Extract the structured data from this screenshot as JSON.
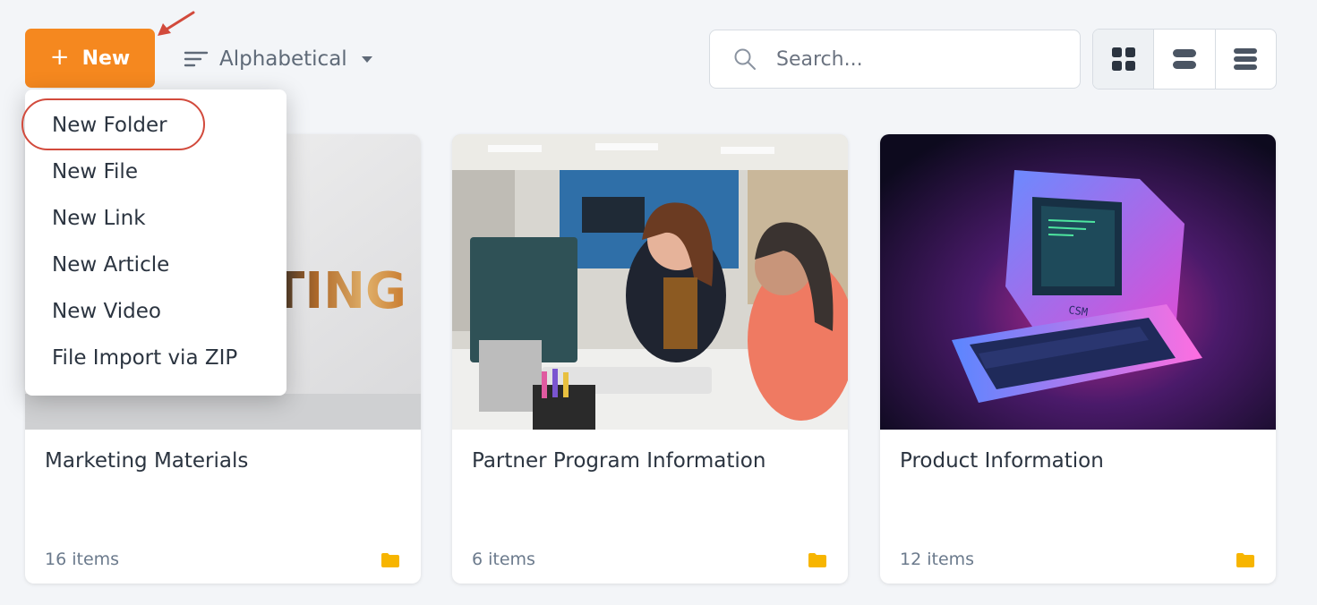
{
  "toolbar": {
    "new_label": "New",
    "new_icon": "plus-icon",
    "sort_label": "Alphabetical",
    "search_placeholder": "Search...",
    "accent_color": "#f5881f",
    "views": [
      "grid-view-icon",
      "list-view-icon",
      "compact-list-view-icon"
    ]
  },
  "menu": {
    "items": [
      {
        "label": "New Folder"
      },
      {
        "label": "New File"
      },
      {
        "label": "New Link"
      },
      {
        "label": "New Article"
      },
      {
        "label": "New Video"
      },
      {
        "label": "File Import via ZIP"
      }
    ]
  },
  "folders": [
    {
      "title": "Marketing Materials",
      "count": "16 items",
      "thumb_text": "TING"
    },
    {
      "title": "Partner Program Information",
      "count": "6 items"
    },
    {
      "title": "Product Information",
      "count": "12 items",
      "screen_text": "CSM"
    }
  ],
  "annotation_color": "#d24a3c",
  "folder_icon_color": "#f7b500"
}
